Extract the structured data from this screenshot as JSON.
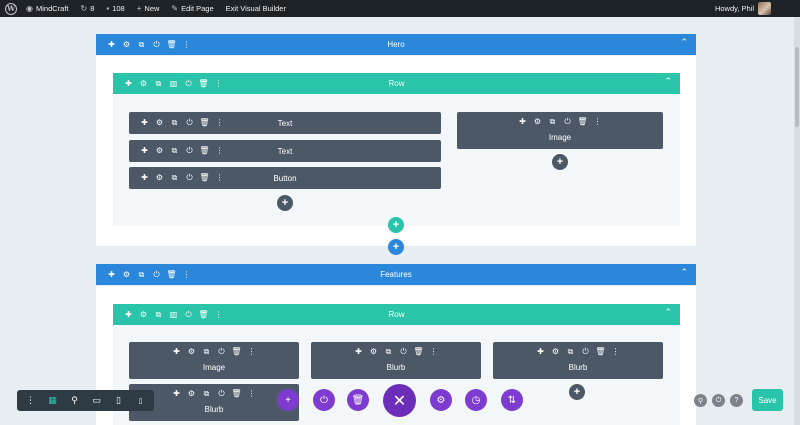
{
  "admin_bar": {
    "site": "MindCraft",
    "updates": "8",
    "comments": "108",
    "new": "New",
    "edit_page": "Edit Page",
    "exit": "Exit Visual Builder",
    "greeting": "Howdy, Phil"
  },
  "sections": [
    {
      "label": "Hero"
    },
    {
      "label": "Features"
    }
  ],
  "rows": [
    {
      "label": "Row"
    },
    {
      "label": "Row"
    }
  ],
  "hero_modules": {
    "col1": [
      "Text",
      "Text",
      "Button"
    ],
    "col2": [
      "Image"
    ]
  },
  "features_modules": {
    "col1": [
      "Image",
      "Blurb"
    ],
    "col2": [
      "Blurb"
    ],
    "col3": [
      "Blurb"
    ]
  },
  "glyphs": {
    "plus": "✚",
    "gear": "⚙",
    "copy": "⧉",
    "columns": "▥",
    "power": "⏻",
    "trash": "🗑",
    "more": "⋮",
    "chevron_up": "⌃",
    "add": "+",
    "close": "✕",
    "history": "◷",
    "sort": "⇅",
    "search": "⚲",
    "help": "?",
    "desktop": "▭",
    "tablet": "▯",
    "phone": "▯",
    "grid": "▦"
  },
  "save_label": "Save",
  "colors": {
    "section": "#2b87da",
    "row": "#29c4a9",
    "module": "#4c5866",
    "builder": "#7e3bd0",
    "save": "#29c4a9"
  }
}
